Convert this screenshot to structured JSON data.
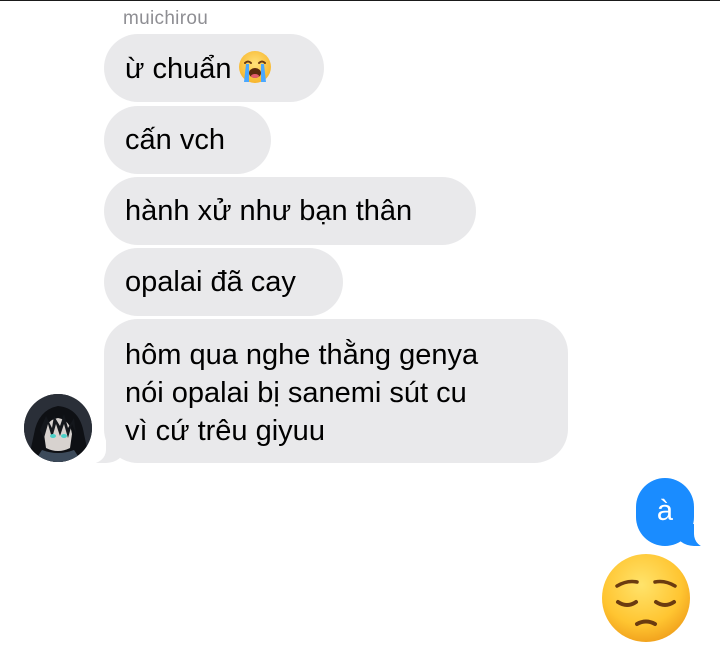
{
  "conversation": {
    "contact_name": "muichirou",
    "incoming_messages": [
      {
        "text": "ừ chuẩn",
        "emoji": "loudly-crying-face"
      },
      {
        "text": "cấn vch"
      },
      {
        "text": "hành xử như bạn thân"
      },
      {
        "text": "opalai đã cay"
      },
      {
        "lines": [
          "hôm qua nghe thằng genya",
          "nói opalai bị sanemi sút cu",
          "vì cứ trêu giyuu"
        ]
      }
    ],
    "outgoing_messages": [
      {
        "text": "à"
      },
      {
        "emoji": "pensive-face"
      }
    ]
  },
  "colors": {
    "incoming_bubble": "#e9e9eb",
    "outgoing_bubble": "#1a8cff",
    "sender_name": "#8e8e93",
    "emoji_yellow": "#ffcb3d"
  }
}
